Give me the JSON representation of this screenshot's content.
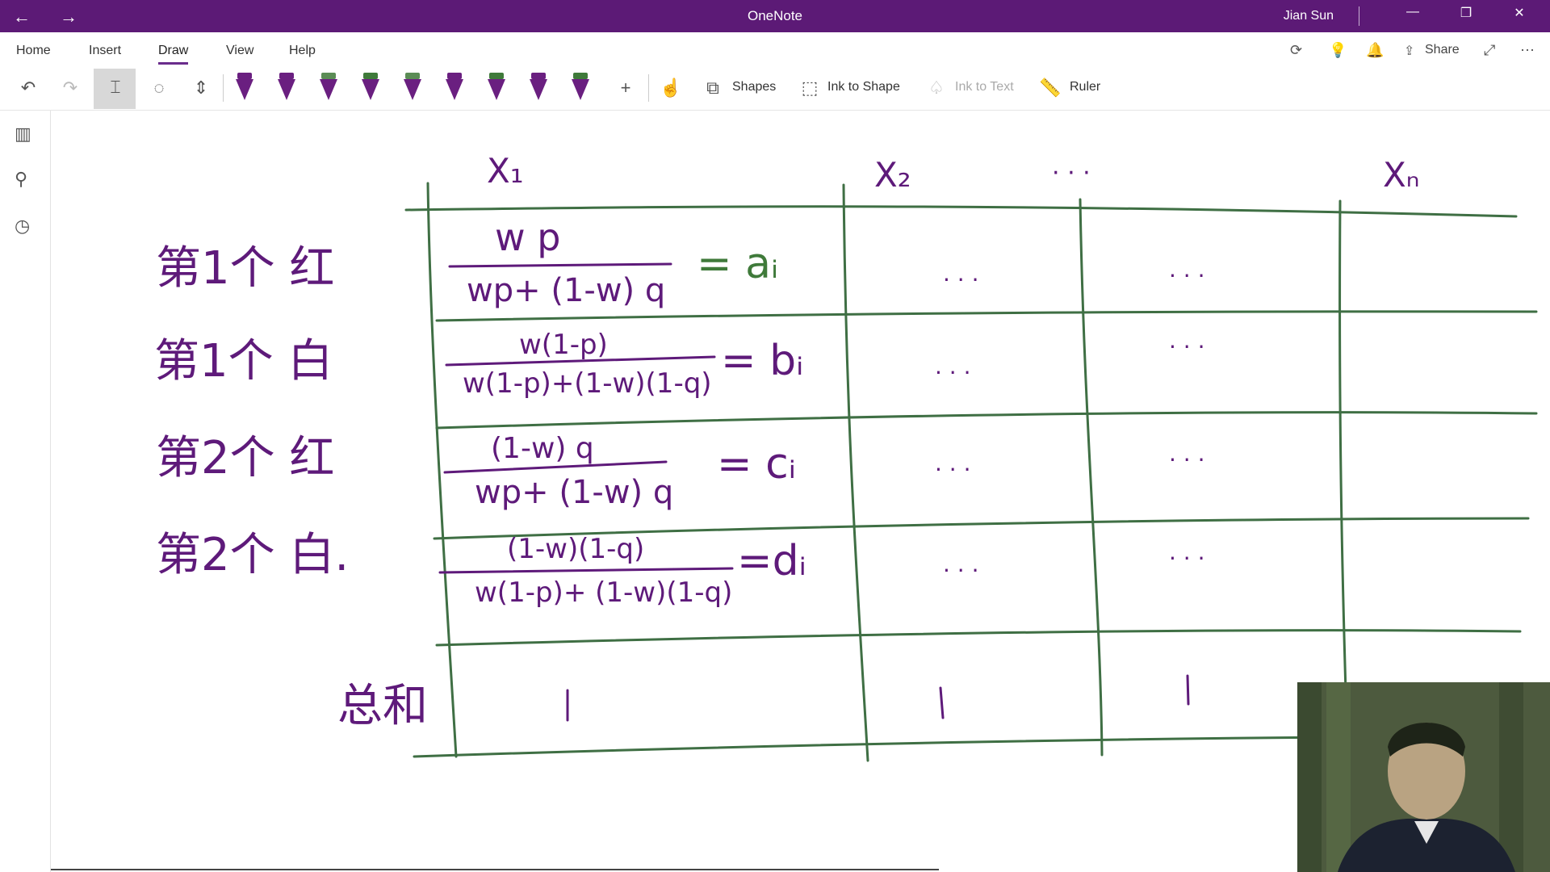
{
  "titlebar": {
    "back_glyph": "←",
    "forward_glyph": "→",
    "app_title": "OneNote",
    "user_name": "Jian Sun",
    "minimize_glyph": "—",
    "restore_glyph": "❐",
    "close_glyph": "✕"
  },
  "tabs": [
    {
      "label": "Home"
    },
    {
      "label": "Insert"
    },
    {
      "label": "Draw"
    },
    {
      "label": "View"
    },
    {
      "label": "Help"
    }
  ],
  "header_actions": {
    "share_label": "Share",
    "more_glyph": "⋯"
  },
  "toolbar": {
    "shapes_label": "Shapes",
    "ink_to_shape_label": "Ink to Shape",
    "ink_to_text_label": "Ink to Text",
    "ruler_label": "Ruler",
    "add_pen_glyph": "+"
  },
  "pens": [
    {
      "name": "pen-1",
      "color": "#6a1f80",
      "cap": "#6a1f80"
    },
    {
      "name": "pen-2",
      "color": "#6a1f80",
      "cap": "#6a1f80"
    },
    {
      "name": "pen-3",
      "color": "#6a1f80",
      "cap": "#5b8c55"
    },
    {
      "name": "pen-4",
      "color": "#6a1f80",
      "cap": "#3f7a3a"
    },
    {
      "name": "pen-5",
      "color": "#6a1f80",
      "cap": "#5b8c55"
    },
    {
      "name": "pen-6",
      "color": "#6a1f80",
      "cap": "#6a1f80"
    },
    {
      "name": "pen-7",
      "color": "#6a1f80",
      "cap": "#3f7a3a"
    },
    {
      "name": "pen-8",
      "color": "#6a1f80",
      "cap": "#6a1f80"
    },
    {
      "name": "pen-9",
      "color": "#6a1f80",
      "cap": "#3f7a3a"
    }
  ],
  "note": {
    "col_headers": [
      "X₁",
      "X₂",
      "· · ·",
      "Xₙ"
    ],
    "row_labels": [
      "第1个 红",
      "第1个 白",
      "第2个 红",
      "第2个 白."
    ],
    "formulas": [
      {
        "num": "w p",
        "den": "wp+ (1-w) q",
        "result": "= aᵢ"
      },
      {
        "num": "w(1-p)",
        "den": "w(1-p)+(1-w)(1-q)",
        "result": "= bᵢ"
      },
      {
        "num": "(1-w) q",
        "den": "wp+ (1-w) q",
        "result": "= cᵢ"
      },
      {
        "num": "(1-w)(1-q)",
        "den": "w(1-p)+ (1-w)(1-q)",
        "result": "=dᵢ"
      }
    ],
    "cell_dots": ". . .",
    "sum_label": "总和",
    "sum_values": [
      "1",
      "1",
      "1"
    ]
  },
  "colors": {
    "title_bar": "#5c1a76",
    "ink_purple": "#5e1a7a",
    "ink_green": "#3f7a3a"
  }
}
